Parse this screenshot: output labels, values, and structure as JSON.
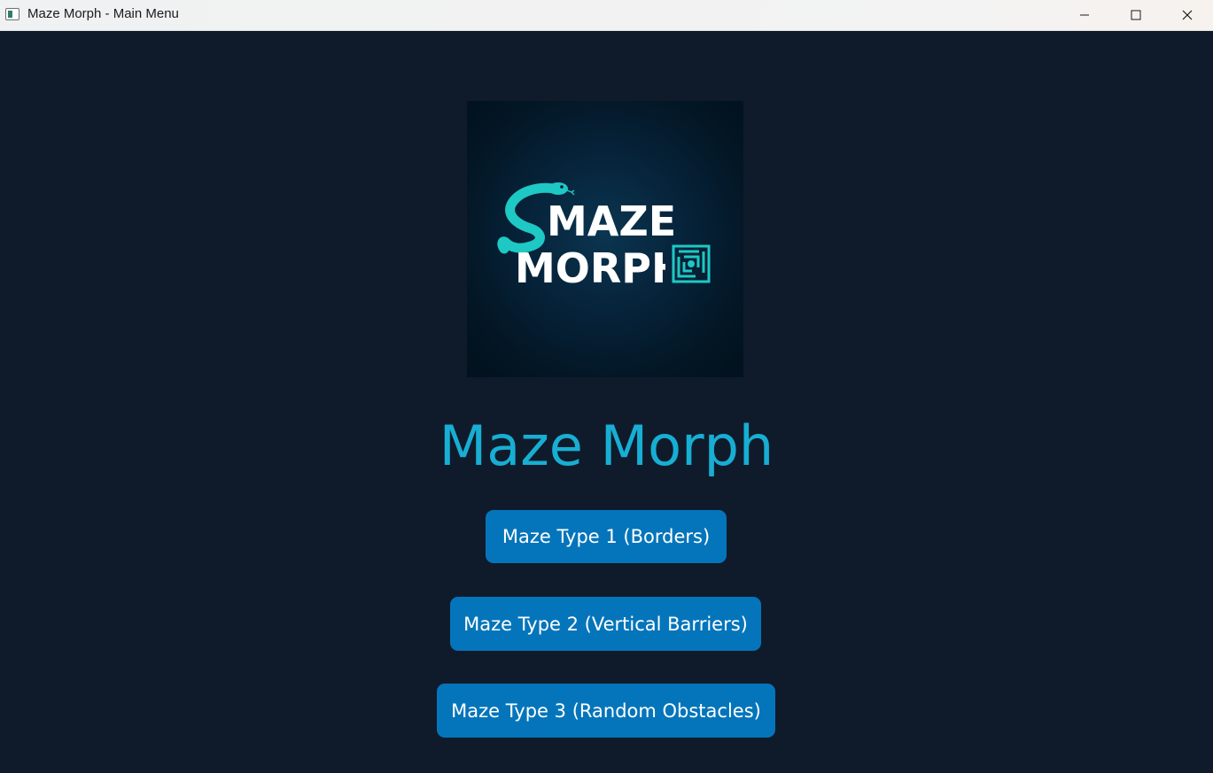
{
  "window": {
    "title": "Maze Morph - Main Menu",
    "icon": "app-window-icon",
    "controls": {
      "minimize_icon": "minimize-icon",
      "maximize_icon": "maximize-icon",
      "close_icon": "close-icon"
    }
  },
  "logo": {
    "line1": "MAZE",
    "line2": "MORPH",
    "icons": [
      "snake-icon",
      "maze-icon"
    ],
    "colors": {
      "text": "#ffffff",
      "accent": "#1ec8c4",
      "background": "#03192a"
    }
  },
  "main": {
    "title": "Maze Morph",
    "title_color": "#18aed3",
    "buttons": [
      {
        "label": "Maze Type 1 (Borders)"
      },
      {
        "label": "Maze Type 2 (Vertical Barriers)"
      },
      {
        "label": "Maze Type 3 (Random Obstacles)"
      }
    ],
    "button_color": "#0575bb",
    "background_color": "#0f1b2b"
  }
}
